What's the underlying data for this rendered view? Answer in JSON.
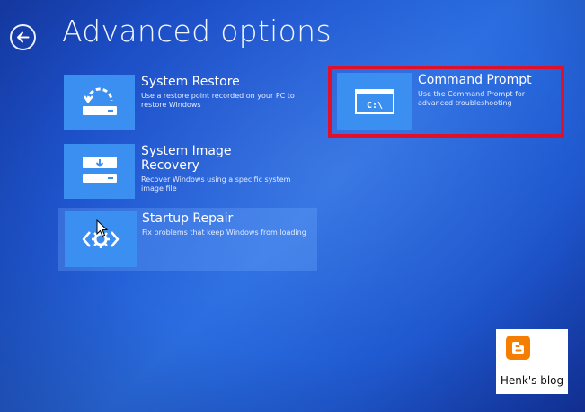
{
  "header": {
    "title": "Advanced options"
  },
  "tiles": [
    {
      "title": "System Restore",
      "desc": "Use a restore point recorded on your PC to restore Windows",
      "icon": "system-restore-icon"
    },
    {
      "title": "System Image Recovery",
      "desc": "Recover Windows using a specific system image file",
      "icon": "system-image-icon"
    },
    {
      "title": "Startup Repair",
      "desc": "Fix problems that keep Windows from loading",
      "icon": "startup-repair-icon"
    },
    {
      "title": "Command Prompt",
      "desc": "Use the Command Prompt for advanced troubleshooting",
      "icon": "command-prompt-icon",
      "icon_text": "C:\\"
    }
  ],
  "watermark": {
    "name": "Henk's blog",
    "icon": "blogger-logo-icon"
  },
  "colors": {
    "background": "#1f56d0",
    "tile": "#3a8ff0",
    "highlight": "#e0102a",
    "blogger": "#f57d00"
  }
}
